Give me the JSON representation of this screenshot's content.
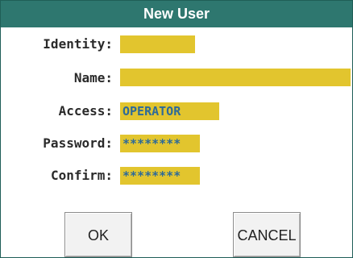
{
  "dialog": {
    "title": "New User"
  },
  "form": {
    "identity": {
      "label": "Identity:",
      "value": ""
    },
    "name": {
      "label": "Name:",
      "value": ""
    },
    "access": {
      "label": "Access:",
      "value": "OPERATOR"
    },
    "password": {
      "label": "Password:",
      "value": "********"
    },
    "confirm": {
      "label": "Confirm:",
      "value": "********"
    }
  },
  "buttons": {
    "ok_label": "OK",
    "cancel_label": "CANCEL"
  },
  "colors": {
    "title_bar": "#2e776f",
    "field_fill": "#e2c52e",
    "field_text": "#2d6a99"
  }
}
